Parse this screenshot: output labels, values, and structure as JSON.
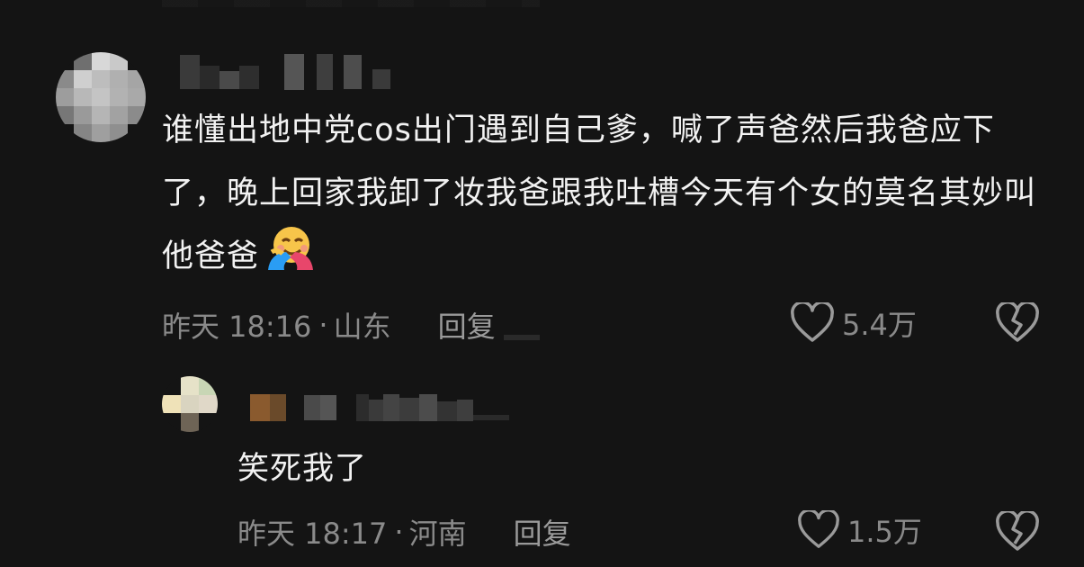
{
  "comment": {
    "text": "谁懂出地中党cos出门遇到自己爹，喊了声爸然后我爸应下了，晚上回家我卸了妆我爸跟我吐槽今天有个女的莫名其妙叫他爸爸",
    "emoji": "hugging-face-emoji",
    "time": "昨天 18:16",
    "separator": "·",
    "location": "山东",
    "reply_label": "回复",
    "like_count": "5.4万"
  },
  "reply": {
    "text": "笑死我了",
    "time": "昨天 18:17",
    "separator": "·",
    "location": "河南",
    "reply_label": "回复",
    "like_count": "1.5万"
  },
  "icons": {
    "like": "heart-outline-icon",
    "dislike": "broken-heart-icon"
  },
  "colors": {
    "background": "#141414",
    "text": "#f2f2f2",
    "meta": "#8a8a8a"
  }
}
